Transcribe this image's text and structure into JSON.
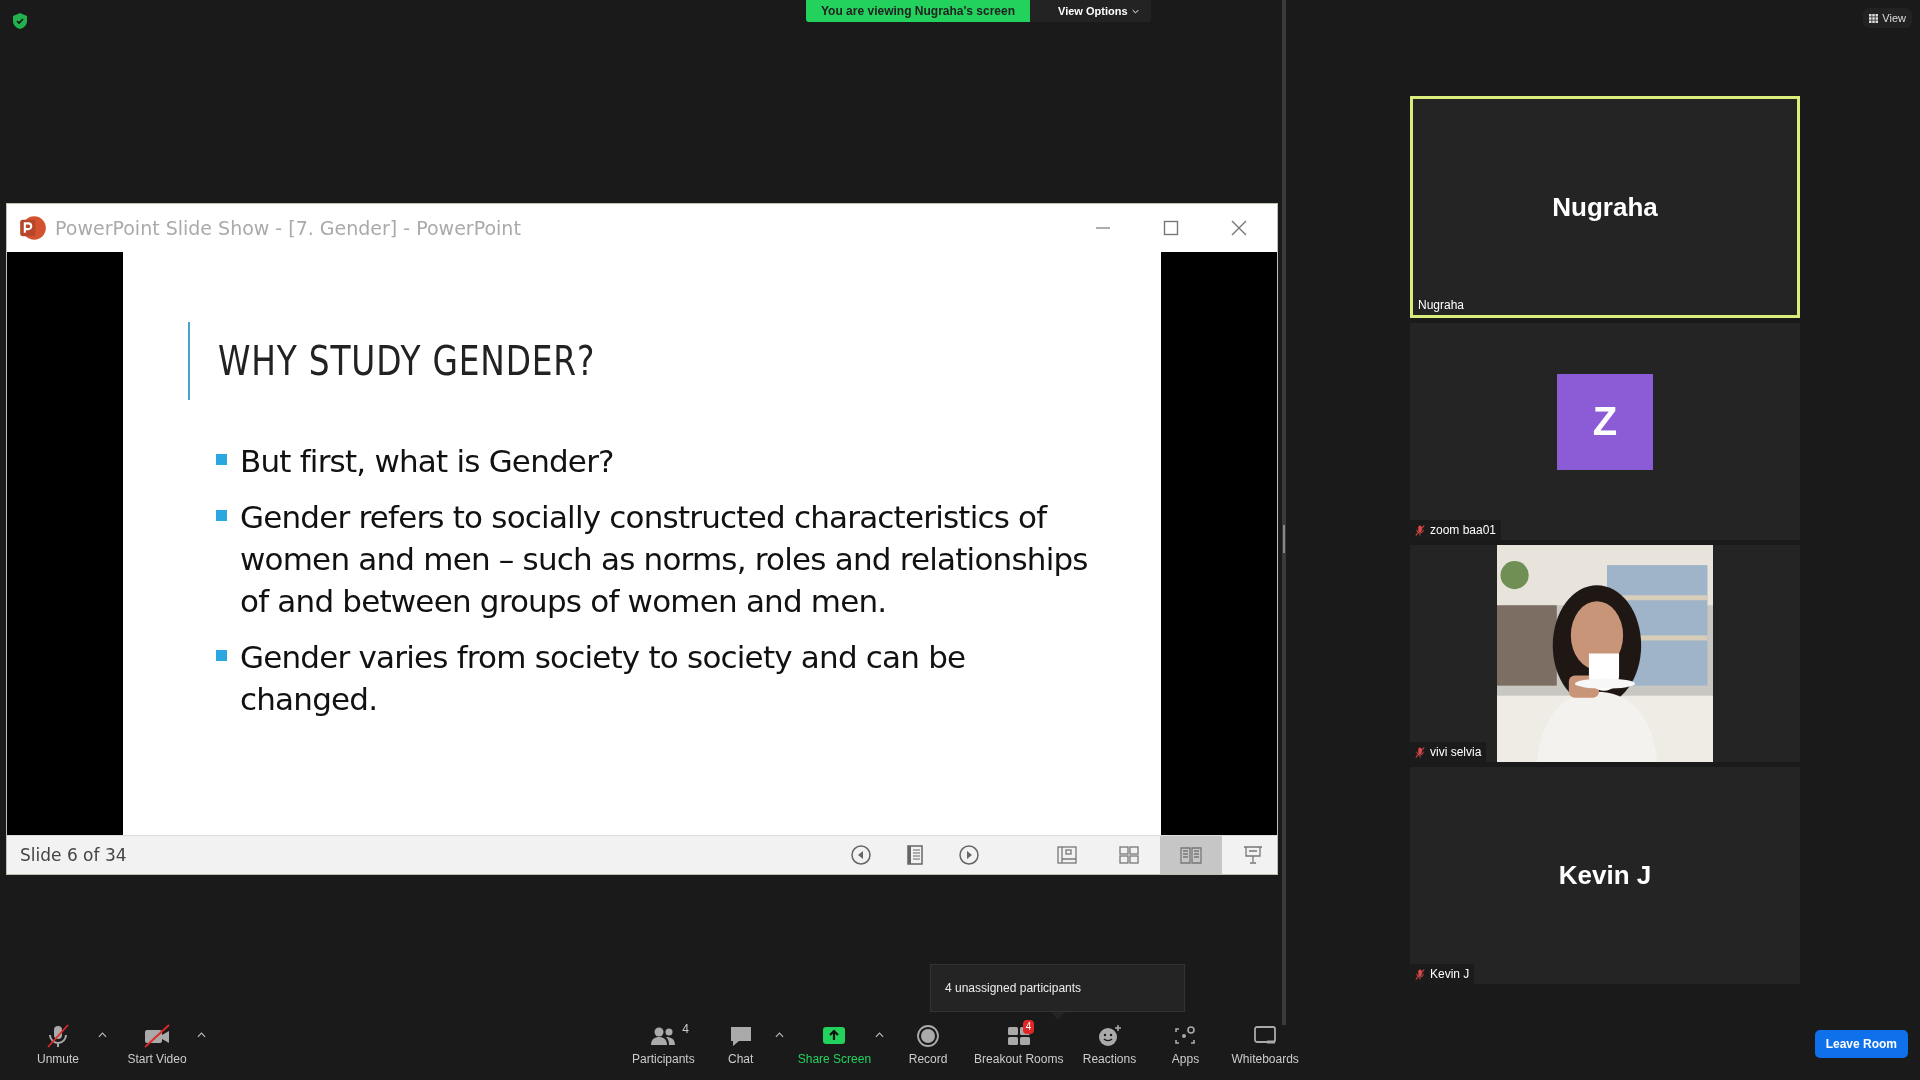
{
  "share_banner": {
    "text": "You are viewing Nugraha's screen",
    "view_options": "View Options"
  },
  "view_button": "View",
  "presentation_window": {
    "title": "PowerPoint Slide Show - [7. Gender] - PowerPoint",
    "slide": {
      "title": "WHY STUDY GENDER?",
      "bullets": [
        "But first, what is Gender?",
        "Gender refers to socially constructed characteristics of women and men – such as norms, roles and relationships of and between groups of women and men.",
        "Gender varies from society to society and can be changed."
      ]
    },
    "status": "Slide 6 of 34",
    "view_buttons": [
      {
        "kind": "normal",
        "selected": false
      },
      {
        "kind": "sorter",
        "selected": false
      },
      {
        "kind": "reading",
        "selected": true
      },
      {
        "kind": "slideshow",
        "selected": false
      }
    ]
  },
  "participants": [
    {
      "name": "Nugraha",
      "kind": "name",
      "display_name": "Nugraha",
      "active": true,
      "muted": false
    },
    {
      "name": "zoom baa01",
      "kind": "avatar",
      "avatar_letter": "Z",
      "active": false,
      "muted": true
    },
    {
      "name": "vivi selvia",
      "kind": "video",
      "active": false,
      "muted": true
    },
    {
      "name": "Kevin J",
      "kind": "name",
      "display_name": "Kevin J",
      "active": false,
      "muted": true
    }
  ],
  "toolbar_left": [
    {
      "kind": "mic-off",
      "label": "Unmute",
      "menu": true
    },
    {
      "kind": "video-off",
      "label": "Start Video",
      "menu": true
    }
  ],
  "toolbar_center": [
    {
      "kind": "participants",
      "label": "Participants",
      "count": "4",
      "menu": false
    },
    {
      "kind": "chat",
      "label": "Chat",
      "menu": true
    },
    {
      "kind": "share",
      "label": "Share Screen",
      "menu": true
    },
    {
      "kind": "record",
      "label": "Record",
      "menu": false
    },
    {
      "kind": "breakout",
      "label": "Breakout Rooms",
      "badge": "4",
      "menu": false
    },
    {
      "kind": "reactions",
      "label": "Reactions",
      "menu": false
    },
    {
      "kind": "apps",
      "label": "Apps",
      "menu": false
    },
    {
      "kind": "whiteboards",
      "label": "Whiteboards",
      "menu": false
    }
  ],
  "tooltip": "4 unassigned participants",
  "leave_button": "Leave Room"
}
